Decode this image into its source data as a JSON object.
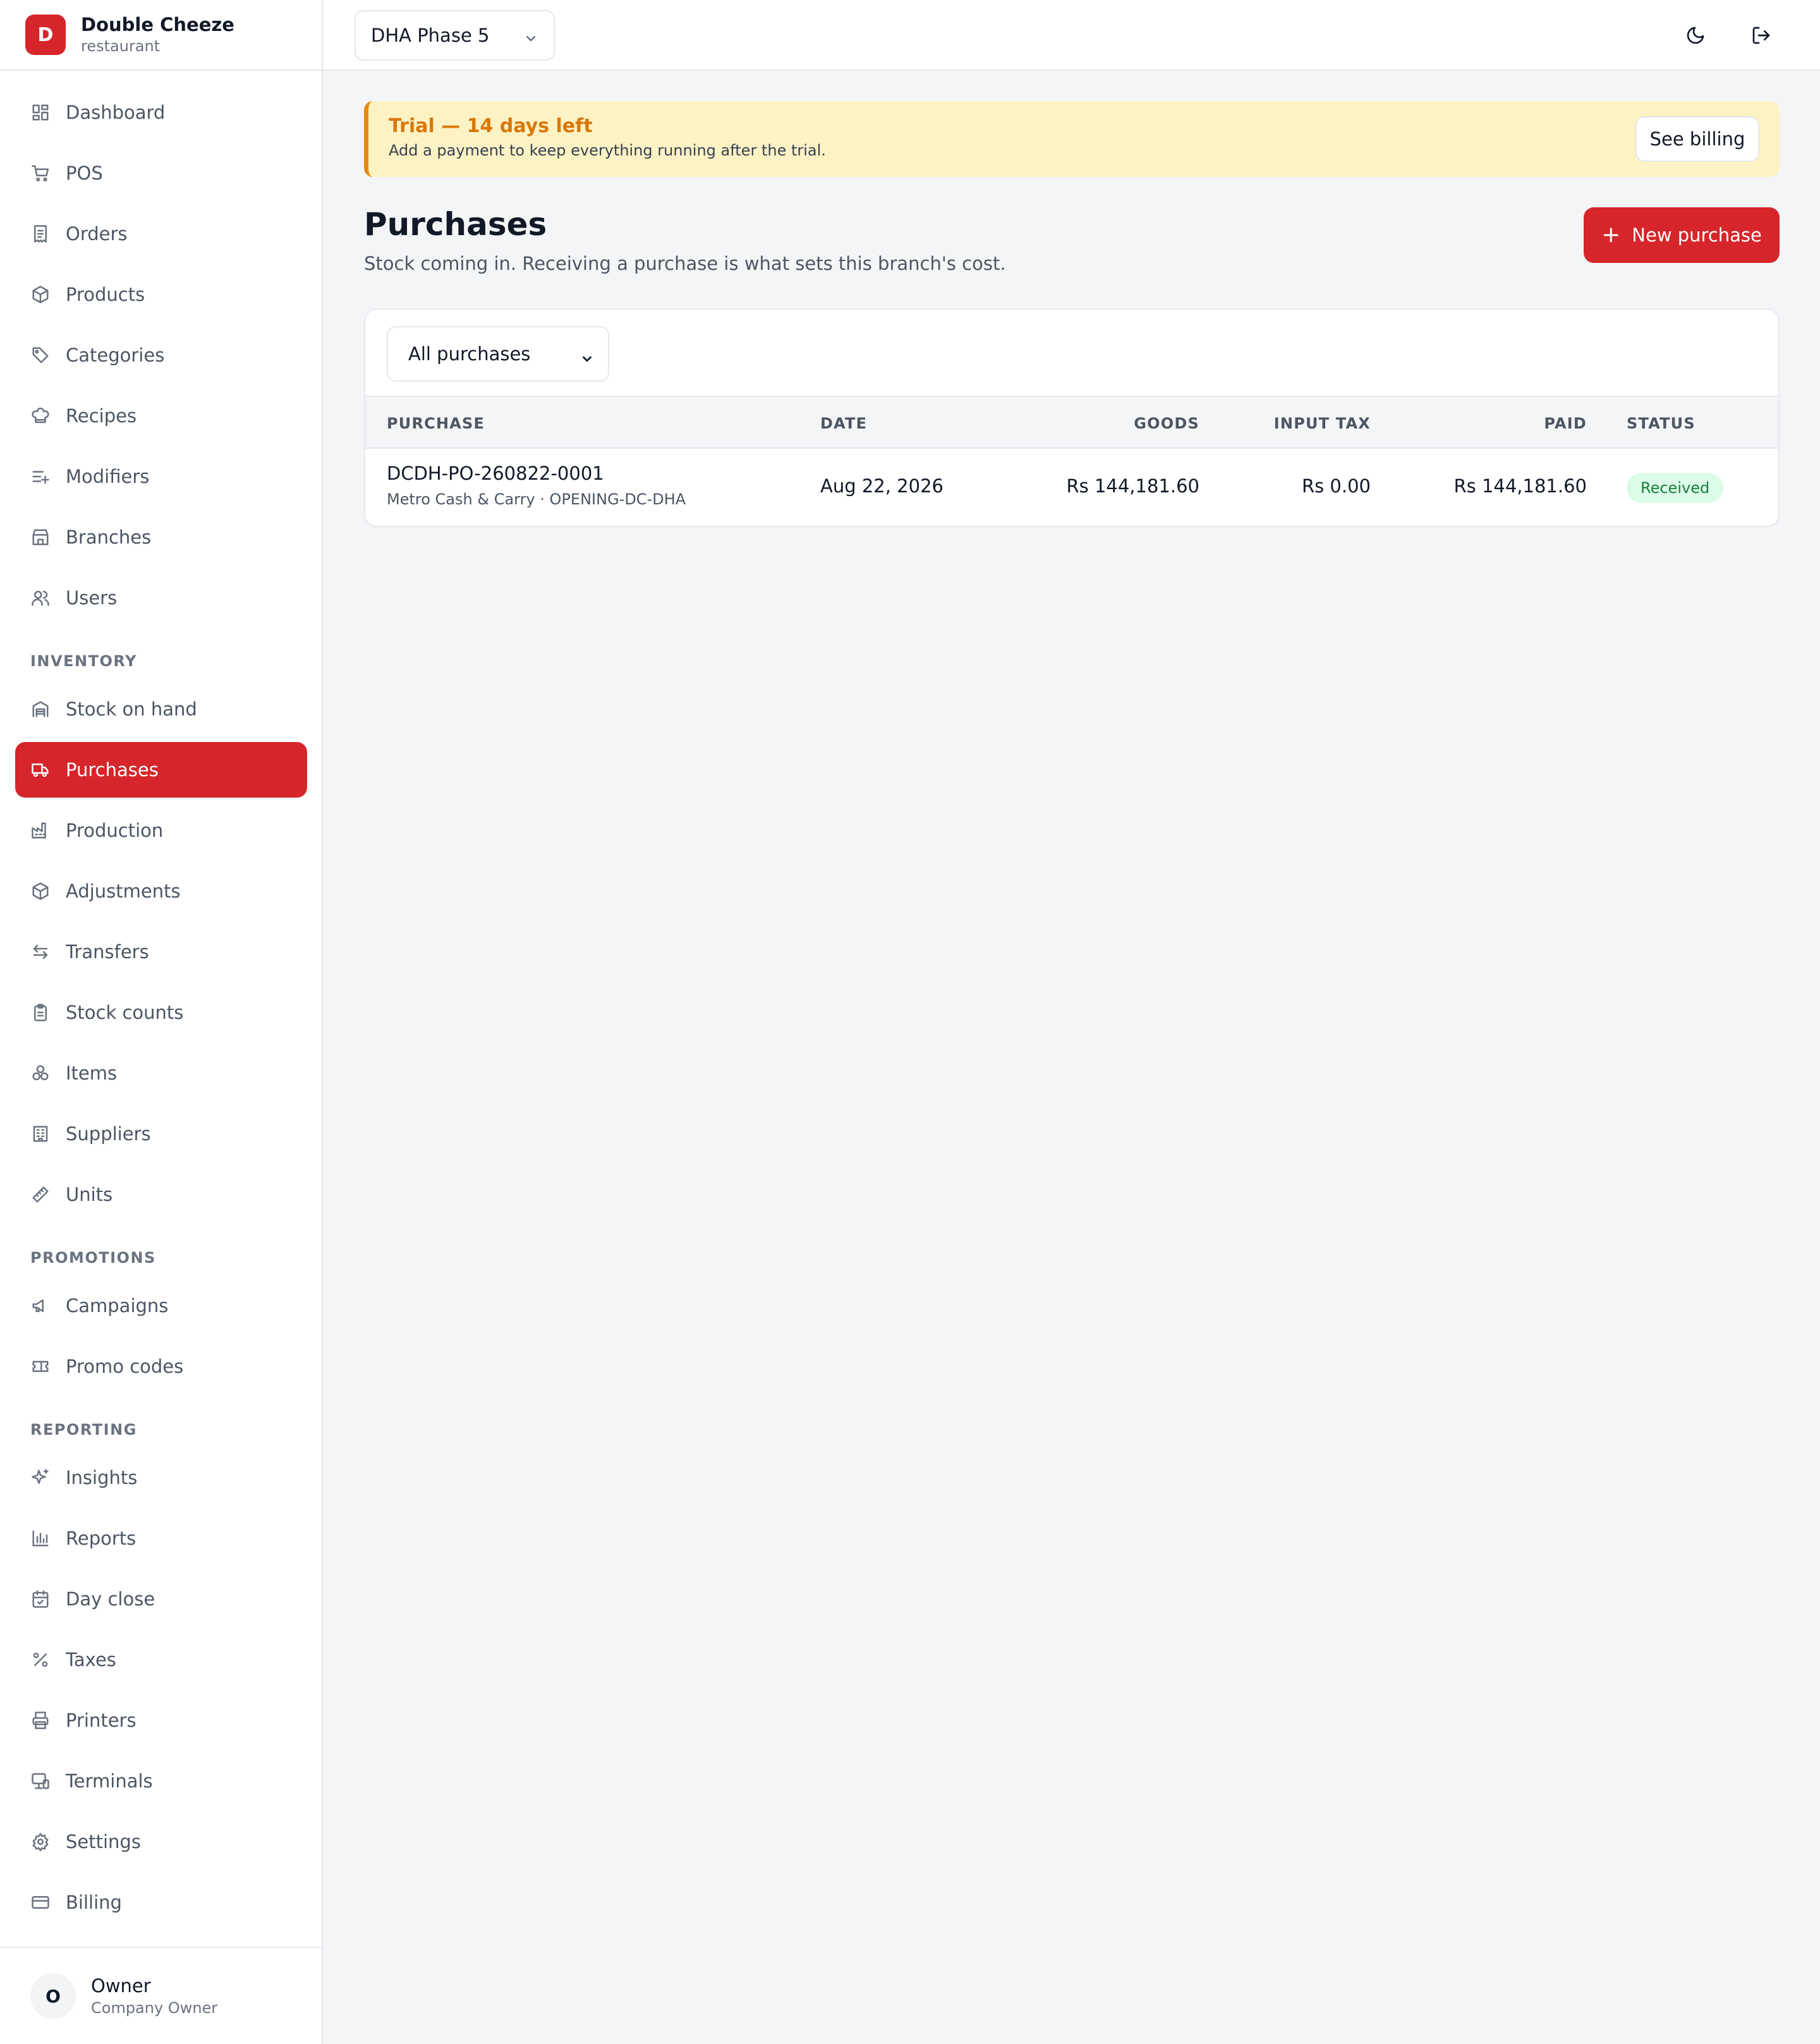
{
  "brand": {
    "logo_letter": "D",
    "name": "Double Cheeze",
    "subtitle": "restaurant"
  },
  "sidebar": {
    "main_items": [
      {
        "label": "Dashboard",
        "icon": "dashboard-icon"
      },
      {
        "label": "POS",
        "icon": "cart-icon"
      },
      {
        "label": "Orders",
        "icon": "receipt-icon"
      },
      {
        "label": "Products",
        "icon": "box-icon"
      },
      {
        "label": "Categories",
        "icon": "tag-icon"
      },
      {
        "label": "Recipes",
        "icon": "chef-hat-icon"
      },
      {
        "label": "Modifiers",
        "icon": "list-plus-icon"
      },
      {
        "label": "Branches",
        "icon": "store-icon"
      },
      {
        "label": "Users",
        "icon": "users-icon"
      }
    ],
    "inventory_label": "INVENTORY",
    "inventory_items": [
      {
        "label": "Stock on hand",
        "icon": "warehouse-icon"
      },
      {
        "label": "Purchases",
        "icon": "truck-icon",
        "active": true
      },
      {
        "label": "Production",
        "icon": "factory-icon"
      },
      {
        "label": "Adjustments",
        "icon": "box-edit-icon"
      },
      {
        "label": "Transfers",
        "icon": "arrows-exchange-icon"
      },
      {
        "label": "Stock counts",
        "icon": "clipboard-icon"
      },
      {
        "label": "Items",
        "icon": "boxes-icon"
      },
      {
        "label": "Suppliers",
        "icon": "building-icon"
      },
      {
        "label": "Units",
        "icon": "ruler-icon"
      }
    ],
    "promotions_label": "PROMOTIONS",
    "promotions_items": [
      {
        "label": "Campaigns",
        "icon": "megaphone-icon"
      },
      {
        "label": "Promo codes",
        "icon": "ticket-icon"
      }
    ],
    "reporting_label": "REPORTING",
    "reporting_items": [
      {
        "label": "Insights",
        "icon": "sparkles-icon"
      },
      {
        "label": "Reports",
        "icon": "bar-chart-icon"
      },
      {
        "label": "Day close",
        "icon": "calendar-check-icon"
      },
      {
        "label": "Taxes",
        "icon": "percent-icon"
      },
      {
        "label": "Printers",
        "icon": "printer-icon"
      },
      {
        "label": "Terminals",
        "icon": "monitor-icon"
      },
      {
        "label": "Settings",
        "icon": "gear-icon"
      },
      {
        "label": "Billing",
        "icon": "credit-card-icon"
      }
    ]
  },
  "user": {
    "initial": "O",
    "name": "Owner",
    "role": "Company Owner"
  },
  "topbar": {
    "branch": "DHA Phase 5",
    "theme_icon": "moon-icon",
    "logout_icon": "logout-icon"
  },
  "trial": {
    "title": "Trial — 14 days left",
    "message": "Add a payment to keep everything running after the trial.",
    "button": "See billing"
  },
  "page": {
    "title": "Purchases",
    "subtitle": "Stock coming in. Receiving a purchase is what sets this branch's cost.",
    "new_button": "New purchase"
  },
  "filter": {
    "selected": "All purchases"
  },
  "table": {
    "headers": {
      "purchase": "PURCHASE",
      "date": "DATE",
      "goods": "GOODS",
      "input_tax": "INPUT TAX",
      "paid": "PAID",
      "status": "STATUS"
    },
    "rows": [
      {
        "id": "DCDH-PO-260822-0001",
        "meta": "Metro Cash & Carry · OPENING-DC-DHA",
        "date": "Aug 22, 2026",
        "goods": "Rs 144,181.60",
        "input_tax": "Rs 0.00",
        "paid": "Rs 144,181.60",
        "status": "Received"
      }
    ]
  },
  "colors": {
    "accent": "#d6262b",
    "trial_bg": "#fdf2c4",
    "trial_title": "#d97706",
    "status_green": "#15803d"
  }
}
